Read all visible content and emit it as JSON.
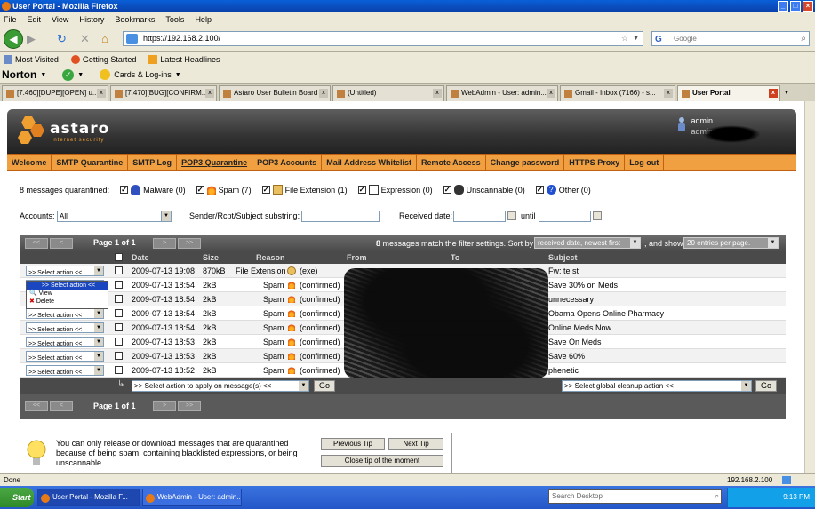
{
  "window": {
    "title": "User Portal - Mozilla Firefox"
  },
  "menu": [
    "File",
    "Edit",
    "View",
    "History",
    "Bookmarks",
    "Tools",
    "Help"
  ],
  "nav": {
    "url": "https://192.168.2.100/",
    "search_placeholder": "Google"
  },
  "bookmarks": [
    "Most Visited",
    "Getting Started",
    "Latest Headlines"
  ],
  "norton": {
    "brand": "Norton",
    "cards": "Cards & Log-ins"
  },
  "tabs": [
    {
      "label": "[7.460][DUPE][OPEN] u..."
    },
    {
      "label": "[7.470][BUG][CONFIRM..."
    },
    {
      "label": "Astaro User Bulletin Board"
    },
    {
      "label": "(Untitled)"
    },
    {
      "label": "WebAdmin - User: admin..."
    },
    {
      "label": "Gmail - Inbox (7166) - s..."
    },
    {
      "label": "User Portal"
    }
  ],
  "portal": {
    "logo": "astaro",
    "logo_sub": "internet security",
    "admin_user": "admin",
    "admin_user2": "admin",
    "nav": [
      "Welcome",
      "SMTP Quarantine",
      "SMTP Log",
      "POP3 Quarantine",
      "POP3 Accounts",
      "Mail Address Whitelist",
      "Remote Access",
      "Change password",
      "HTTPS Proxy",
      "Log out"
    ],
    "quarantine_summary": "8 messages quarantined:",
    "categories": [
      {
        "label": "Malware (0)",
        "icon": "malware-icon"
      },
      {
        "label": "Spam (7)",
        "icon": "flame-icon"
      },
      {
        "label": "File Extension (1)",
        "icon": "package-icon"
      },
      {
        "label": "Expression (0)",
        "icon": "expression-icon"
      },
      {
        "label": "Unscannable (0)",
        "icon": "unscannable-icon"
      },
      {
        "label": "Other (0)",
        "icon": "question-icon"
      }
    ],
    "filters": {
      "accounts_label": "Accounts:",
      "accounts_value": "All",
      "substring_label": "Sender/Rcpt/Subject substring:",
      "received_label": "Received date:",
      "until_label": "until"
    },
    "pager": {
      "first": "<<",
      "prev": "<",
      "next": ">",
      "last": ">>",
      "page_text": "Page 1 of 1",
      "match_count": "8",
      "match_text": "messages match the filter settings. Sort by",
      "sort_value": "received date, newest first",
      "show_text": ", and show",
      "per_page": "20 entries per page."
    },
    "columns": [
      "Date",
      "Size",
      "Reason",
      "From",
      "To",
      "Subject"
    ],
    "action_placeholder": ">> Select action <<",
    "rows": [
      {
        "date": "2009-07-13 19:08",
        "size": "870kB",
        "reason": "File Extension",
        "detail": "(exe)",
        "subject": "Fw: te st"
      },
      {
        "date": "2009-07-13 18:54",
        "size": "2kB",
        "reason": "Spam",
        "detail": "(confirmed)",
        "subject": "Save 30% on Meds"
      },
      {
        "date": "2009-07-13 18:54",
        "size": "2kB",
        "reason": "Spam",
        "detail": "(confirmed)",
        "subject": "unnecessary"
      },
      {
        "date": "2009-07-13 18:54",
        "size": "2kB",
        "reason": "Spam",
        "detail": "(confirmed)",
        "subject": "Obama Opens Online Pharmacy"
      },
      {
        "date": "2009-07-13 18:54",
        "size": "2kB",
        "reason": "Spam",
        "detail": "(confirmed)",
        "subject": "Online Meds Now"
      },
      {
        "date": "2009-07-13 18:53",
        "size": "2kB",
        "reason": "Spam",
        "detail": "(confirmed)",
        "subject": "Save On Meds"
      },
      {
        "date": "2009-07-13 18:53",
        "size": "2kB",
        "reason": "Spam",
        "detail": "(confirmed)",
        "subject": "Save 60%"
      },
      {
        "date": "2009-07-13 18:52",
        "size": "2kB",
        "reason": "Spam",
        "detail": "(confirmed)",
        "subject": "phenetic"
      }
    ],
    "dropdown": {
      "selected": ">> Select action <<",
      "options": [
        "View",
        "Delete"
      ]
    },
    "bulk": {
      "apply_select": ">> Select action to apply on message(s) <<",
      "go": "Go",
      "global_select": ">> Select global cleanup action <<",
      "go2": "Go"
    },
    "tip": {
      "text": "You can only release or download messages that are quarantined because of being spam, containing blacklisted expressions, or being unscannable.",
      "prev": "Previous Tip",
      "next": "Next Tip",
      "close": "Close tip of the moment"
    }
  },
  "status": {
    "left": "Done",
    "ip": "192.168.2.100"
  },
  "taskbar": {
    "start": "Start",
    "items": [
      "User Portal - Mozilla F...",
      "WebAdmin - User: admin..."
    ],
    "search": "Search Desktop",
    "time": "9:13 PM"
  }
}
